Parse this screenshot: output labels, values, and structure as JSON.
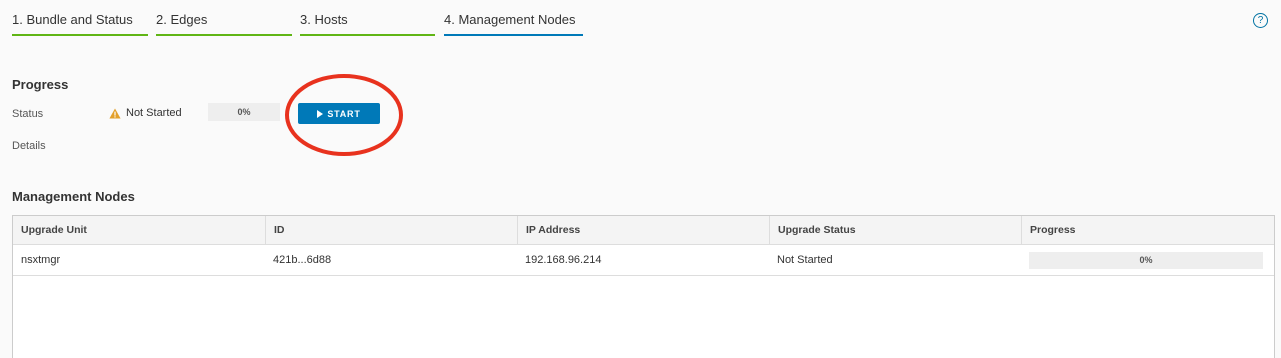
{
  "wizard": {
    "steps": [
      {
        "label": "1. Bundle and Status",
        "state": "complete"
      },
      {
        "label": "2. Edges",
        "state": "complete"
      },
      {
        "label": "3. Hosts",
        "state": "complete"
      },
      {
        "label": "4. Management Nodes",
        "state": "active"
      }
    ],
    "colors": {
      "complete": "#60b515",
      "active": "#0079b8"
    },
    "help_icon": "?"
  },
  "progress": {
    "title": "Progress",
    "status_label": "Status",
    "status_value": "Not Started",
    "status_icon": "warning-triangle-icon",
    "percent_text": "0%",
    "percent": 0,
    "start_label": "START",
    "details_label": "Details"
  },
  "management_nodes": {
    "title": "Management Nodes",
    "columns": [
      "Upgrade Unit",
      "ID",
      "IP Address",
      "Upgrade Status",
      "Progress"
    ],
    "rows": [
      {
        "upgrade_unit": "nsxtmgr",
        "id": "421b...6d88",
        "ip_address": "192.168.96.214",
        "upgrade_status": "Not Started",
        "progress_text": "0%",
        "progress": 0
      }
    ]
  },
  "colors": {
    "accent": "#0079b8",
    "warning": "#e3a02b",
    "annotation": "#e8321e"
  }
}
